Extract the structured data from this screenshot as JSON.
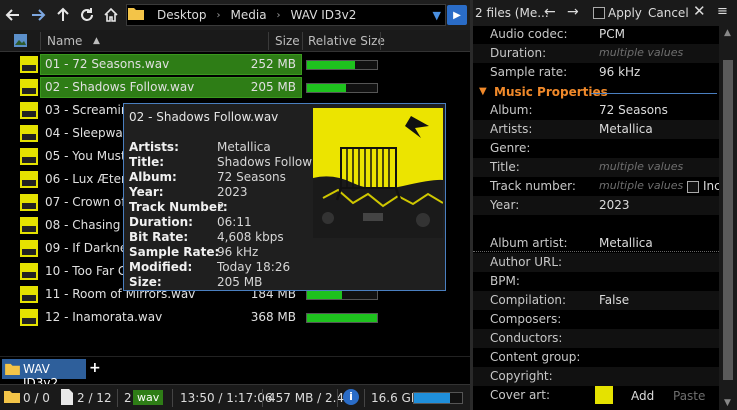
{
  "toolbar": {
    "back_icon": "arrow-left-icon",
    "forward_icon": "arrow-right-icon",
    "up_icon": "arrow-up-icon",
    "refresh_icon": "refresh-icon",
    "home_icon": "home-icon",
    "breadcrumbs": [
      "Desktop",
      "Media",
      "WAV ID3v2"
    ]
  },
  "columns": {
    "name": "Name",
    "size": "Size",
    "relative_size": "Relative Size"
  },
  "files": [
    {
      "name": "01 - 72 Seasons.wav",
      "size": "252 MB",
      "rel": 0.68,
      "selected": true
    },
    {
      "name": "02 - Shadows Follow.wav",
      "size": "205 MB",
      "rel": 0.55,
      "selected": true
    },
    {
      "name": "03 - Screaming",
      "size": "",
      "rel": 0,
      "selected": false
    },
    {
      "name": "04 - Sleepwalk",
      "size": "",
      "rel": 0,
      "selected": false
    },
    {
      "name": "05 - You Must B",
      "size": "",
      "rel": 0,
      "selected": false
    },
    {
      "name": "06 - Lux Æterna",
      "size": "",
      "rel": 0,
      "selected": false
    },
    {
      "name": "07 - Crown of E",
      "size": "",
      "rel": 0,
      "selected": false
    },
    {
      "name": "08 - Chasing Li",
      "size": "",
      "rel": 0,
      "selected": false
    },
    {
      "name": "09 - If Darkness",
      "size": "",
      "rel": 0,
      "selected": false
    },
    {
      "name": "10 - Too Far Go",
      "size": "",
      "rel": 0,
      "selected": false
    },
    {
      "name": "11 - Room of Mirrors.wav",
      "size": "184 MB",
      "rel": 0.5,
      "selected": false
    },
    {
      "name": "12 - Inamorata.wav",
      "size": "368 MB",
      "rel": 1.0,
      "selected": false
    }
  ],
  "tooltip": {
    "title": "02 - Shadows Follow.wav",
    "fields": [
      {
        "k": "Artists:",
        "v": "Metallica"
      },
      {
        "k": "Title:",
        "v": "Shadows Follow"
      },
      {
        "k": "Album:",
        "v": "72 Seasons"
      },
      {
        "k": "Year:",
        "v": "2023"
      },
      {
        "k": "Track Number:",
        "v": "2"
      },
      {
        "k": "Duration:",
        "v": "06:11"
      },
      {
        "k": "Bit Rate:",
        "v": "4,608 kbps"
      },
      {
        "k": "Sample Rate:",
        "v": "96 kHz"
      },
      {
        "k": "Modified:",
        "v": "Today 18:26"
      },
      {
        "k": "Size:",
        "v": "205 MB"
      }
    ]
  },
  "tab": {
    "label": "WAV ID3v2",
    "add": "+"
  },
  "status": {
    "folders": "0 / 0",
    "files": "2 / 12",
    "type_count": "2",
    "type_badge": "wav",
    "duration": "13:50 / 1:17:06",
    "size": "457 MB / 2.4",
    "disk": "16.6 GB",
    "disk_fill": 0.75
  },
  "meta_panel": {
    "title": "2 files (Me...",
    "apply_label": "Apply",
    "cancel_label": "Cancel",
    "close": "✕",
    "section_music": "Music Properties",
    "top_rows": [
      {
        "k": "Audio codec:",
        "v": "PCM",
        "multi": false
      },
      {
        "k": "Duration:",
        "v": "multiple values",
        "multi": true
      },
      {
        "k": "Sample rate:",
        "v": "96 kHz",
        "multi": false
      }
    ],
    "music_rows": [
      {
        "k": "Album:",
        "v": "72 Seasons",
        "multi": false
      },
      {
        "k": "Artists:",
        "v": "Metallica",
        "multi": false
      },
      {
        "k": "Genre:",
        "v": "",
        "multi": false
      },
      {
        "k": "Title:",
        "v": "multiple values",
        "multi": true
      },
      {
        "k": "Track number:",
        "v": "multiple values",
        "multi": true
      },
      {
        "k": "Year:",
        "v": "2023",
        "multi": false
      }
    ],
    "include_label": "Inc",
    "more_rows": [
      {
        "k": "Album artist:",
        "v": "Metallica",
        "multi": false
      },
      {
        "k": "Author URL:",
        "v": "",
        "multi": false
      },
      {
        "k": "BPM:",
        "v": "",
        "multi": false
      },
      {
        "k": "Compilation:",
        "v": "False",
        "multi": false
      },
      {
        "k": "Composers:",
        "v": "",
        "multi": false
      },
      {
        "k": "Conductors:",
        "v": "",
        "multi": false
      },
      {
        "k": "Content group:",
        "v": "",
        "multi": false
      },
      {
        "k": "Copyright:",
        "v": "",
        "multi": false
      },
      {
        "k": "Cover art:",
        "v": "",
        "multi": false
      }
    ],
    "cover_add": "Add",
    "cover_paste": "Paste"
  }
}
